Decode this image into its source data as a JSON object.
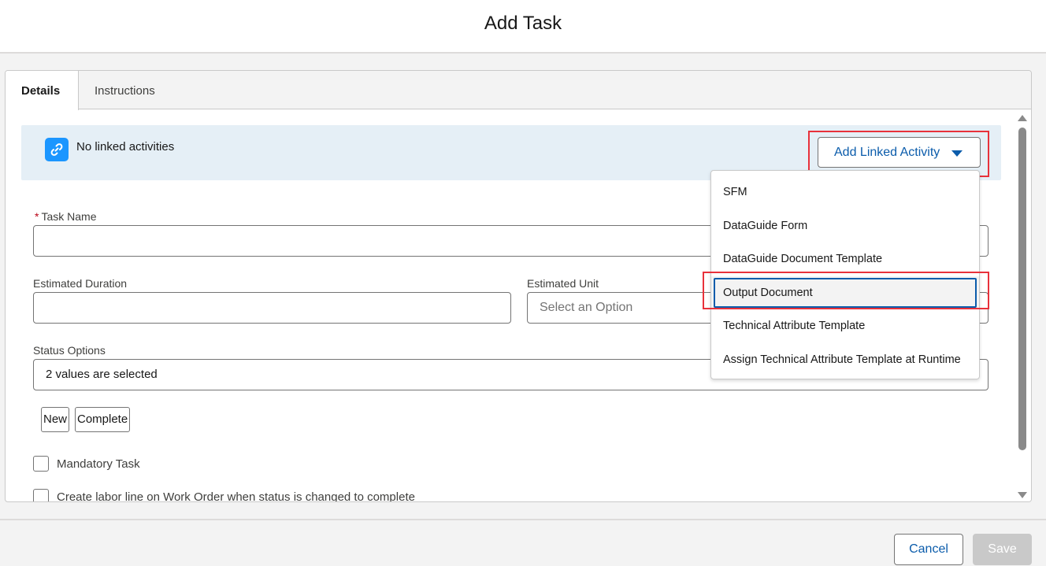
{
  "modal": {
    "title": "Add Task"
  },
  "tabs": [
    {
      "label": "Details",
      "active": true
    },
    {
      "label": "Instructions",
      "active": false
    }
  ],
  "linked": {
    "icon": "link-icon",
    "text": "No linked activities",
    "add_button_label": "Add Linked Activity"
  },
  "dropdown": {
    "items": [
      {
        "label": "SFM",
        "focused": false
      },
      {
        "label": "DataGuide Form",
        "focused": false
      },
      {
        "label": "DataGuide Document Template",
        "focused": false
      },
      {
        "label": "Output Document",
        "focused": true
      },
      {
        "label": "Technical Attribute Template",
        "focused": false
      },
      {
        "label": "Assign Technical Attribute Template at Runtime",
        "focused": false
      }
    ]
  },
  "form": {
    "task_name": {
      "label": "Task Name",
      "required_mark": "*",
      "value": ""
    },
    "estimated_duration": {
      "label": "Estimated Duration",
      "value": ""
    },
    "estimated_unit": {
      "label": "Estimated Unit",
      "placeholder": "Select an Option"
    },
    "status_options": {
      "label": "Status Options",
      "value": "2 values are selected",
      "chips": [
        "New",
        "Complete"
      ]
    },
    "mandatory_task": {
      "label": "Mandatory Task",
      "checked": false
    },
    "labor_line": {
      "label": "Create labor line on Work Order when status is changed to complete",
      "checked": false
    }
  },
  "footer": {
    "cancel_label": "Cancel",
    "save_label": "Save"
  },
  "colors": {
    "brand_blue": "#0b5cab",
    "link_icon_bg": "#1b96ff",
    "highlight_red": "#e8313b",
    "linked_bar_bg": "#e5eff6"
  }
}
